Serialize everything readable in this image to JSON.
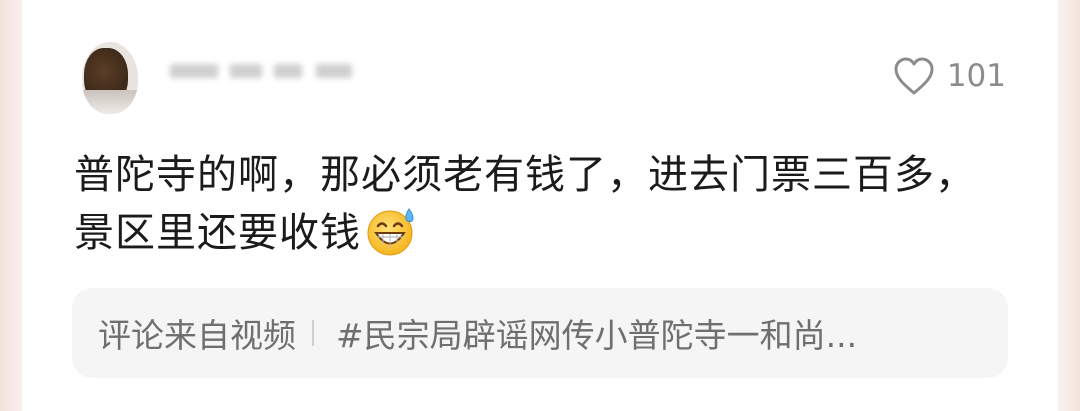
{
  "comment": {
    "like_count": "101",
    "text": "普陀寺的啊，那必须老有钱了，进去门票三百多，景区里还要收钱",
    "emoji": "grinning-sweat-emoji",
    "source": {
      "label": "评论来自视频",
      "video_title": "#民宗局辟谣网传小普陀寺一和尚..."
    }
  },
  "colors": {
    "background": "#ffffff",
    "text": "#1b1b1b",
    "muted": "#8c8c8c",
    "source_bg": "#f5f5f5"
  }
}
